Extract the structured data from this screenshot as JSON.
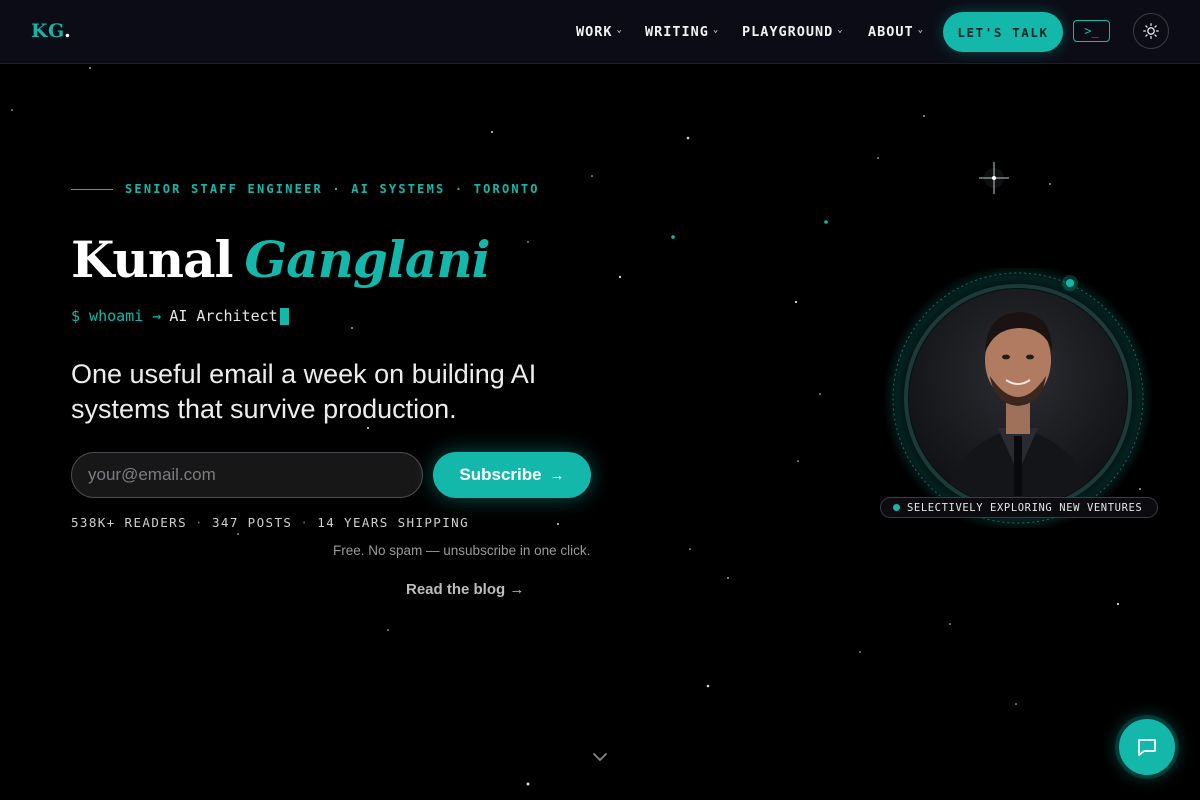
{
  "header": {
    "logo_text": "KG",
    "logo_dot": ".",
    "nav": [
      {
        "label": "WORK"
      },
      {
        "label": "WRITING"
      },
      {
        "label": "PLAYGROUND"
      },
      {
        "label": "ABOUT"
      }
    ],
    "cta_label": "LET'S TALK",
    "terminal_button": ">_",
    "theme_icon": "sun-icon"
  },
  "hero": {
    "eyebrow": "SENIOR STAFF ENGINEER · AI SYSTEMS · TORONTO",
    "first_name": "Kunal",
    "last_name": "Ganglani",
    "terminal_cmd": "$ whoami →",
    "terminal_result": "AI Architect",
    "tagline": "One useful email a week on building AI systems that survive production.",
    "email_placeholder": "your@email.com",
    "subscribe_label": "Subscribe",
    "subscribe_arrow": "→",
    "stats": [
      "538K+ READERS",
      "347 POSTS",
      "14 YEARS SHIPPING"
    ],
    "stats_separator": "·",
    "note": "Free. No spam — unsubscribe in one click.",
    "read_blog": "Read the blog →"
  },
  "profile": {
    "status": "SELECTIVELY EXPLORING NEW VENTURES"
  },
  "colors": {
    "accent": "#14b8aa",
    "background": "#000000",
    "header_bg": "#0b0c16"
  },
  "icons": {
    "scroll": "chevron-down-icon",
    "chat": "chat-bubble-icon"
  }
}
